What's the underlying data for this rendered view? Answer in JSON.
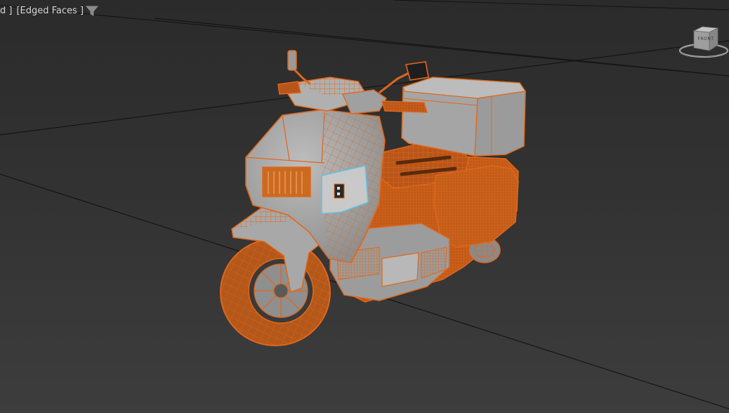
{
  "viewport": {
    "label_left_fragment": "d ]",
    "label_shading": "[Edged Faces ]",
    "filter_icon": "filter-funnel-icon",
    "viewcube": {
      "icon": "viewcube-icon",
      "face_label": "FRONT"
    },
    "colors": {
      "background": "#333333",
      "grid_line": "#141414",
      "mesh_surface": "#a9a9a9",
      "wireframe": "#e0671a",
      "selection": "#5fc4e8",
      "label_text": "#d6d6d6"
    }
  }
}
